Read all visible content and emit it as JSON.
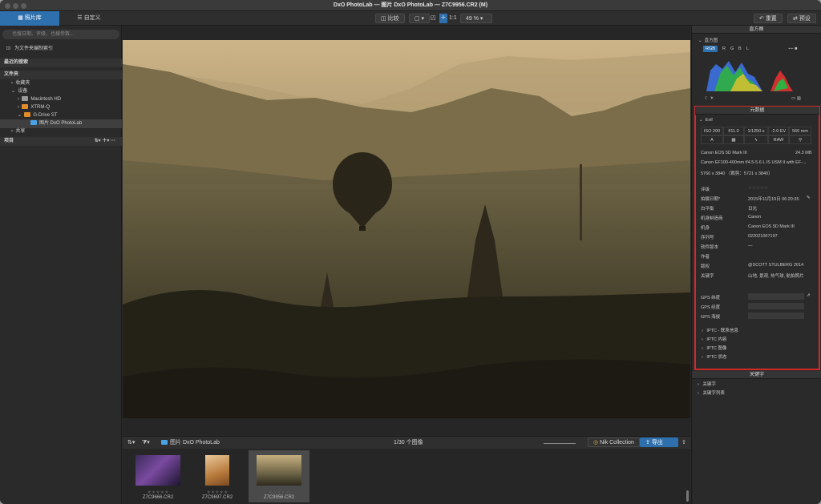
{
  "app": {
    "title": "DxO PhotoLab — 图片 DxO PhotoLab — Z7C9956.CR2 (M)"
  },
  "toolbar": {
    "tab_library": "照片库",
    "tab_customize": "自定义",
    "compare": "比较",
    "ratio": "1:1",
    "zoom": "49 %",
    "reset": "重置",
    "preset": "预设"
  },
  "left": {
    "search_placeholder": "也搜日期、评级、也搜参数...",
    "index_folder": "为文件夹编制索引",
    "recent": "最近的搜索",
    "folders": "文件夹",
    "favorites": "收藏夹",
    "devices": "设备",
    "macintosh": "Macintosh HD",
    "xtrm": "XTRM-Q",
    "gdrive": "G-Drive ST",
    "current": "图片 DxO PhotoLab",
    "shared": "共享",
    "projects": "项目"
  },
  "filmstrip": {
    "folder": "图片 DxO PhotoLab",
    "count": "1/30 个图像",
    "nik": "Nik Collection",
    "export": "导出",
    "thumbs": [
      {
        "name": "Z7C9666.CR2",
        "stars": "★★★★★"
      },
      {
        "name": "Z7C9697.CR2",
        "stars": "★★★★★"
      },
      {
        "name": "Z7C9956.CR2",
        "stars": "★★★★★"
      }
    ]
  },
  "right": {
    "histogram": "直方图",
    "hist_section": "直方图",
    "channels": [
      "RGB",
      "R",
      "G",
      "B",
      "L"
    ],
    "metadata": "元数据",
    "exif": "Exif",
    "exif_cells": [
      "ISO 200",
      "f/11.0",
      "1/1250 s",
      "-2.0 EV",
      "560 mm"
    ],
    "exif_icons": [
      "A",
      "",
      "",
      "RAW",
      ""
    ],
    "camera": "Canon EOS 5D Mark III",
    "size": "24.3 MB",
    "lens": "Canon EF100-400mm f/4.5-5.6 L IS USM II with EF-...",
    "dims": "5760 x 3840 （裁剪：5721 x 3840）",
    "fields": [
      {
        "k": "评级",
        "v": "☆☆☆☆☆"
      },
      {
        "k": "拍摄日期*",
        "v": "2015年11月19日 06:20:35"
      },
      {
        "k": "白平衡",
        "v": "日光"
      },
      {
        "k": "机身制造商",
        "v": "Canon"
      },
      {
        "k": "机身",
        "v": "Canon EOS 5D Mark III"
      },
      {
        "k": "序列号",
        "v": "022021007197"
      },
      {
        "k": "软件版本",
        "v": "—"
      },
      {
        "k": "作者",
        "v": ""
      },
      {
        "k": "版权",
        "v": "@SCOTT STULBERG 2014"
      },
      {
        "k": "关键字",
        "v": "山地, 景观, 热气球, 航拍照片"
      }
    ],
    "gps": [
      "GPS 纬度",
      "GPS 经度",
      "GPS 海拔"
    ],
    "iptc": [
      "IPTC - 联系信息",
      "IPTC 内容",
      "IPTC 图像",
      "IPTC 状态"
    ],
    "keywords": "关键字",
    "kw_items": [
      "关键字",
      "关键字列表"
    ]
  }
}
